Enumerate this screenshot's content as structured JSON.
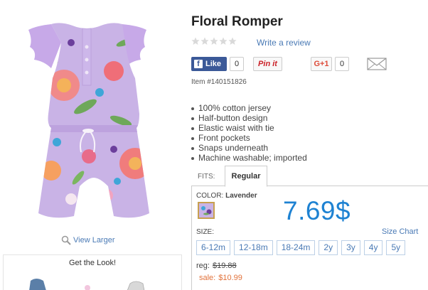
{
  "product": {
    "title": "Floral Romper",
    "item_number": "Item #140151826",
    "rating_stars": 5,
    "write_review": "Write a review",
    "view_larger": "View Larger"
  },
  "social": {
    "fb_label": "Like",
    "fb_count": "0",
    "pin_label": "Pin it",
    "gplus_label": "G+1",
    "gplus_count": "0"
  },
  "features": [
    "100% cotton jersey",
    "Half-button design",
    "Elastic waist with tie",
    "Front pockets",
    "Snaps underneath",
    "Machine washable; imported"
  ],
  "fits": {
    "label": "FITS:",
    "active_tab": "Regular"
  },
  "color": {
    "label": "COLOR:",
    "value": "Lavender",
    "swatch_color": "#c9b3e6"
  },
  "price": {
    "big": "7.69$",
    "reg_label": "reg:",
    "reg_value": "$19.88",
    "sale_label": "sale:",
    "sale_value": "$10.99"
  },
  "size": {
    "label": "SIZE:",
    "chart_link": "Size Chart",
    "options": [
      "6-12m",
      "12-18m",
      "18-24m",
      "2y",
      "3y",
      "4y",
      "5y"
    ]
  },
  "get_look": {
    "title": "Get the Look!"
  },
  "colors": {
    "link": "#4a7ab5",
    "price_blue": "#1e82d2",
    "sale_orange": "#e2723b",
    "facebook": "#3b5998"
  }
}
